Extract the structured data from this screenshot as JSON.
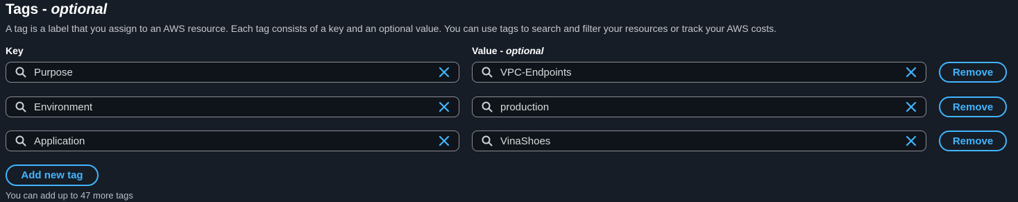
{
  "header": {
    "title": "Tags",
    "title_sep": " - ",
    "title_optional": "optional",
    "description": "A tag is a label that you assign to an AWS resource. Each tag consists of a key and an optional value. You can use tags to search and filter your resources or track your AWS costs."
  },
  "columns": {
    "key_label": "Key",
    "value_label": "Value",
    "value_sep": " - ",
    "value_optional": "optional"
  },
  "tags": [
    {
      "key": "Purpose",
      "value": "VPC-Endpoints",
      "remove_label": "Remove"
    },
    {
      "key": "Environment",
      "value": "production",
      "remove_label": "Remove"
    },
    {
      "key": "Application",
      "value": "VinaShoes",
      "remove_label": "Remove"
    }
  ],
  "add_button_label": "Add new tag",
  "hint": "You can add up to 47 more tags",
  "colors": {
    "background": "#161d26",
    "accent": "#42b4ff",
    "field_border": "#8c8c94"
  },
  "icons": {
    "search": "search-icon",
    "clear": "clear-icon"
  }
}
